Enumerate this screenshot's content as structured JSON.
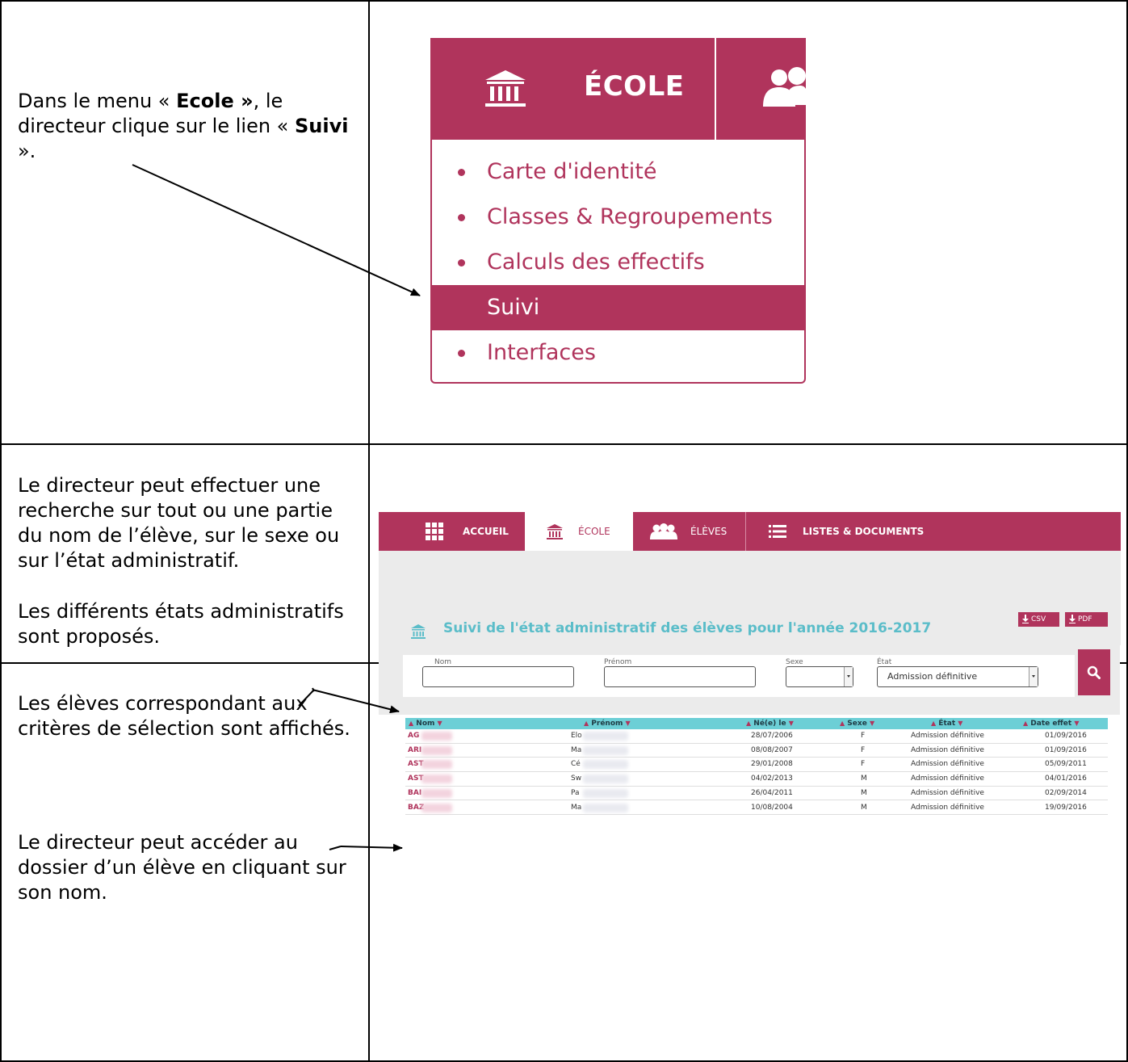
{
  "rows": [
    {
      "description_html_parts": {
        "p1_a": "Dans le menu « ",
        "p1_b": "Ecole »",
        "p1_c": ", le directeur clique sur le lien « ",
        "p1_d": "Suivi",
        "p1_e": " »."
      }
    },
    {
      "description_p1": "Le directeur peut effectuer une recherche sur tout ou une partie du nom de l’élève, sur le sexe ou sur l’état administratif.",
      "description_p2": "Les différents états administratifs sont proposés."
    },
    {
      "description_p1": "Les élèves correspondant aux critères de sélection sont affichés.",
      "description_p2": "Le directeur peut accéder au dossier d’un élève en cliquant sur son nom."
    }
  ],
  "menu": {
    "header_title": "ÉCOLE",
    "items": [
      {
        "label": "Carte d'identité",
        "active": false
      },
      {
        "label": "Classes & Regroupements",
        "active": false
      },
      {
        "label": "Calculs des effectifs",
        "active": false
      },
      {
        "label": "Suivi",
        "active": true
      },
      {
        "label": "Interfaces",
        "active": false
      }
    ]
  },
  "nav": {
    "items": [
      {
        "label": "ACCUEIL",
        "icon": "grid-icon"
      },
      {
        "label": "ÉCOLE",
        "icon": "bank-icon"
      },
      {
        "label": "ÉLÈVES",
        "icon": "people-icon"
      },
      {
        "label": "LISTES & DOCUMENTS",
        "icon": "list-icon"
      }
    ]
  },
  "search": {
    "title": "Suivi de l'état administratif des élèves pour l'année 2016-2017",
    "labels": {
      "nom": "Nom",
      "prenom": "Prénom",
      "sexe": "Sexe",
      "etat": "État"
    },
    "etat_value_empty": "",
    "etat_value_selected": "Admission définitive"
  },
  "export": {
    "csv": "CSV",
    "pdf": "PDF"
  },
  "table": {
    "headers": {
      "nom": "Nom",
      "prenom": "Prénom",
      "ne_le": "Né(e) le",
      "sexe": "Sexe",
      "etat": "État",
      "date_effet": "Date effet"
    },
    "rows": [
      {
        "nom": "AG",
        "prenom": "Elo",
        "ne_le": "28/07/2006",
        "sexe": "F",
        "etat": "Admission définitive",
        "date_effet": "01/09/2016"
      },
      {
        "nom": "ARI",
        "prenom": "Ma",
        "ne_le": "08/08/2007",
        "sexe": "F",
        "etat": "Admission définitive",
        "date_effet": "01/09/2016"
      },
      {
        "nom": "AST",
        "prenom": "Cé",
        "ne_le": "29/01/2008",
        "sexe": "F",
        "etat": "Admission définitive",
        "date_effet": "05/09/2011"
      },
      {
        "nom": "AST",
        "prenom": "Sw",
        "ne_le": "04/02/2013",
        "sexe": "M",
        "etat": "Admission définitive",
        "date_effet": "04/01/2016"
      },
      {
        "nom": "BAI",
        "prenom": "Pa",
        "ne_le": "26/04/2011",
        "sexe": "M",
        "etat": "Admission définitive",
        "date_effet": "02/09/2014"
      },
      {
        "nom": "BAZ",
        "prenom": "Ma",
        "ne_le": "10/08/2004",
        "sexe": "M",
        "etat": "Admission définitive",
        "date_effet": "19/09/2016"
      }
    ]
  },
  "colors": {
    "brand": "#b0345c",
    "accent": "#5bbdc9",
    "table_header": "#6ccfd6"
  }
}
